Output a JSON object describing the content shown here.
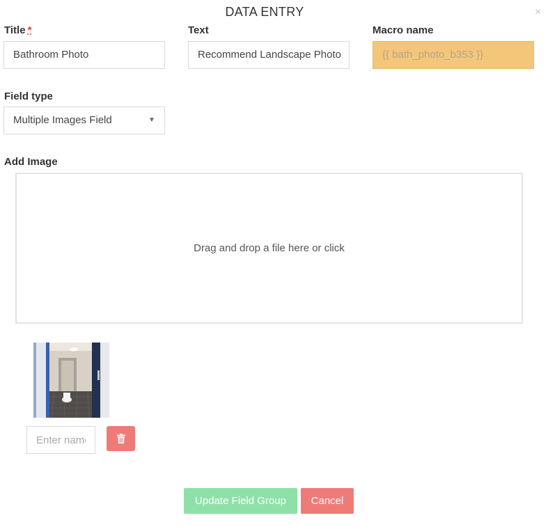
{
  "modal": {
    "title": "DATA ENTRY",
    "close_glyph": "×"
  },
  "form": {
    "title_label": "Title",
    "required_mark": "*",
    "title_value": "Bathroom Photo",
    "text_label": "Text",
    "text_value": "Recommend Landscape Photo",
    "macro_label": "Macro name",
    "macro_value": "{{ bath_photo_b353 }}",
    "field_type_label": "Field type",
    "field_type_value": "Multiple Images Field",
    "add_image_label": "Add Image",
    "dropzone_text": "Drag and drop a file here or click",
    "image_name_placeholder": "Enter name"
  },
  "buttons": {
    "update_label": "Update Field Group",
    "cancel_label": "Cancel"
  },
  "colors": {
    "macro_bg": "#f4c679",
    "update_bg": "#8fe0a8",
    "cancel_bg": "#ee7b78",
    "delete_bg": "#ee7b78"
  },
  "icons": {
    "close": "close-icon",
    "delete": "trash-icon",
    "dropdown": "caret-down-icon"
  }
}
